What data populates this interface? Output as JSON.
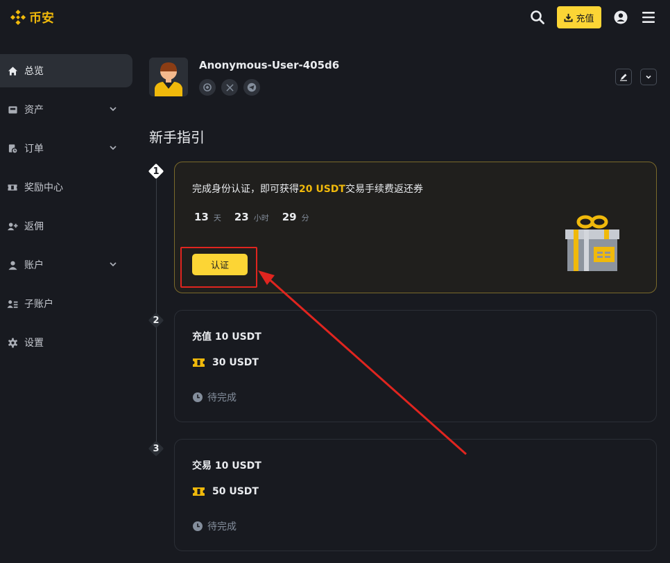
{
  "header": {
    "logo_text": "币安",
    "deposit_label": "充值",
    "icons": [
      "search-icon",
      "download-icon",
      "user-circle-icon",
      "menu-icon"
    ],
    "accent_color": "#fcd535"
  },
  "sidebar": {
    "items": [
      {
        "label": "总览",
        "icon": "home-icon",
        "active": true
      },
      {
        "label": "资产",
        "icon": "wallet-icon",
        "expandable": true
      },
      {
        "label": "订单",
        "icon": "order-icon",
        "expandable": true
      },
      {
        "label": "奖励中心",
        "icon": "ticket-icon"
      },
      {
        "label": "返佣",
        "icon": "user-plus-icon"
      },
      {
        "label": "账户",
        "icon": "user-icon",
        "expandable": true
      },
      {
        "label": "子账户",
        "icon": "sub-account-icon"
      },
      {
        "label": "设置",
        "icon": "gear-icon"
      }
    ]
  },
  "profile": {
    "username": "Anonymous-User-405d6",
    "socials": [
      "binance-icon",
      "x-icon",
      "telegram-icon"
    ]
  },
  "guide": {
    "title": "新手指引",
    "steps": [
      {
        "number": "1",
        "title_prefix": "完成身份认证，即可获得",
        "title_highlight": "20 USDT",
        "title_suffix": "交易手续费返还券",
        "countdown": {
          "days": "13",
          "days_unit": "天",
          "hours": "23",
          "hours_unit": "小时",
          "minutes": "29",
          "minutes_unit": "分"
        },
        "button_label": "认证"
      },
      {
        "number": "2",
        "title": "充值 10 USDT",
        "reward": "30 USDT",
        "status": "待完成"
      },
      {
        "number": "3",
        "title": "交易 10 USDT",
        "reward": "50 USDT",
        "status": "待完成"
      }
    ]
  },
  "annotation": {
    "highlight_color": "#e0251f"
  }
}
